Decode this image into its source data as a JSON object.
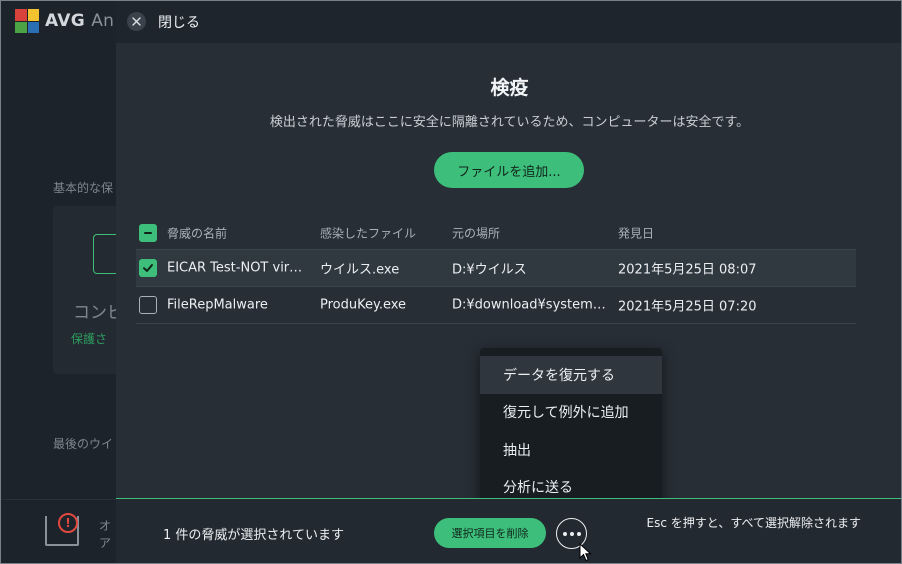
{
  "background": {
    "brand": "AVG",
    "brand_suffix": "An",
    "section1": "基本的な保",
    "card_text": "コンピ",
    "card_sub": "保護さ",
    "section2": "最後のウイ",
    "footer_line1": "オ",
    "footer_line2": "ア",
    "footer_alert": "!"
  },
  "header": {
    "close_label": "閉じる",
    "close_icon": "close-icon"
  },
  "main": {
    "title": "検疫",
    "subtitle": "検出された脅威はここに安全に隔離されているため、コンピューターは安全です。",
    "add_button": "ファイルを追加..."
  },
  "table": {
    "columns": [
      "脅威の名前",
      "感染したファイル",
      "元の場所",
      "発見日"
    ],
    "rows": [
      {
        "name": "EICAR Test-NOT vir…",
        "file": "ウイルス.exe",
        "location": "D:¥ウイルス",
        "date": "2021年5月25日 08:07",
        "checked": true
      },
      {
        "name": "FileRepMalware",
        "file": "ProduKey.exe",
        "location": "D:¥download¥system…",
        "date": "2021年5月25日 07:20",
        "checked": false
      }
    ]
  },
  "context_menu": {
    "items": [
      "データを復元する",
      "復元して例外に追加",
      "抽出",
      "分析に送る"
    ]
  },
  "footer": {
    "selection_status": "1 件の脅威が選択されています",
    "delete_button": "選択項目を削除",
    "esc_hint": "Esc を押すと、すべて選択解除されます"
  },
  "colors": {
    "accent": "#3dbf7b",
    "panel": "#272e36",
    "menu": "#181d22"
  }
}
